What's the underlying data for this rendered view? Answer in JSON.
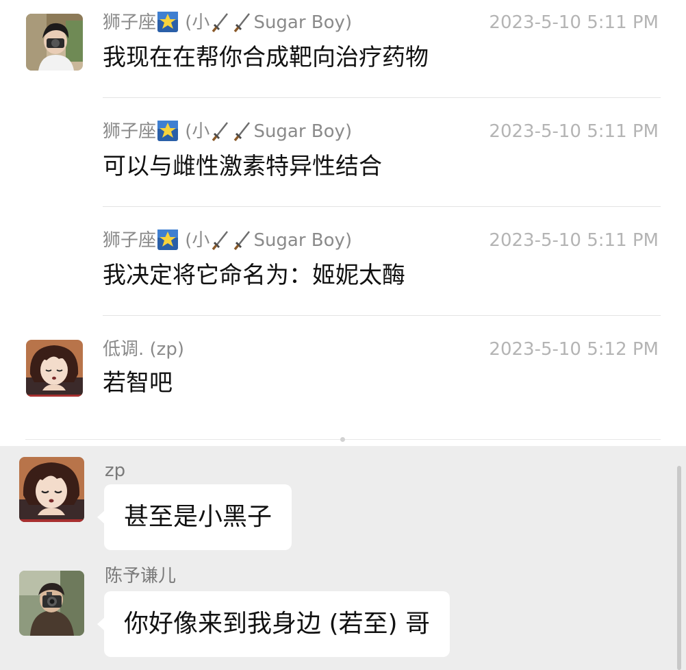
{
  "history": {
    "messages": [
      {
        "sender_name": "狮子座",
        "sender_mid": " (小",
        "sender_end": "Sugar Boy)",
        "time": "2023-5-10 5:11 PM",
        "text": "我现在在帮你合成靶向治疗药物",
        "avatar": "boy-with-camera-avatar"
      },
      {
        "sender_name": "狮子座",
        "sender_mid": " (小",
        "sender_end": "Sugar Boy)",
        "time": "2023-5-10 5:11 PM",
        "text": "可以与雌性激素特异性结合"
      },
      {
        "sender_name": "狮子座",
        "sender_mid": " (小",
        "sender_end": "Sugar Boy)",
        "time": "2023-5-10 5:11 PM",
        "text": "我决定将它命名为：姬妮太酶"
      },
      {
        "sender_full": "低调. (zp)",
        "time": "2023-5-10 5:12 PM",
        "text": "若智吧",
        "avatar": "anime-character-avatar"
      }
    ]
  },
  "chat": {
    "messages": [
      {
        "name": "zp",
        "text": "甚至是小黑子",
        "avatar": "anime-character-avatar"
      },
      {
        "name": "陈予谦儿",
        "text": "你好像来到我身边 (若至) 哥",
        "avatar": "person-with-camera-avatar"
      }
    ]
  },
  "colors": {
    "chat_background": "#ededed",
    "bubble": "#ffffff",
    "secondary_text": "#8a8a8a",
    "time_text": "#b4b4b4"
  },
  "icons": [
    "star-emoji-icon",
    "dagger-emoji-icon"
  ]
}
